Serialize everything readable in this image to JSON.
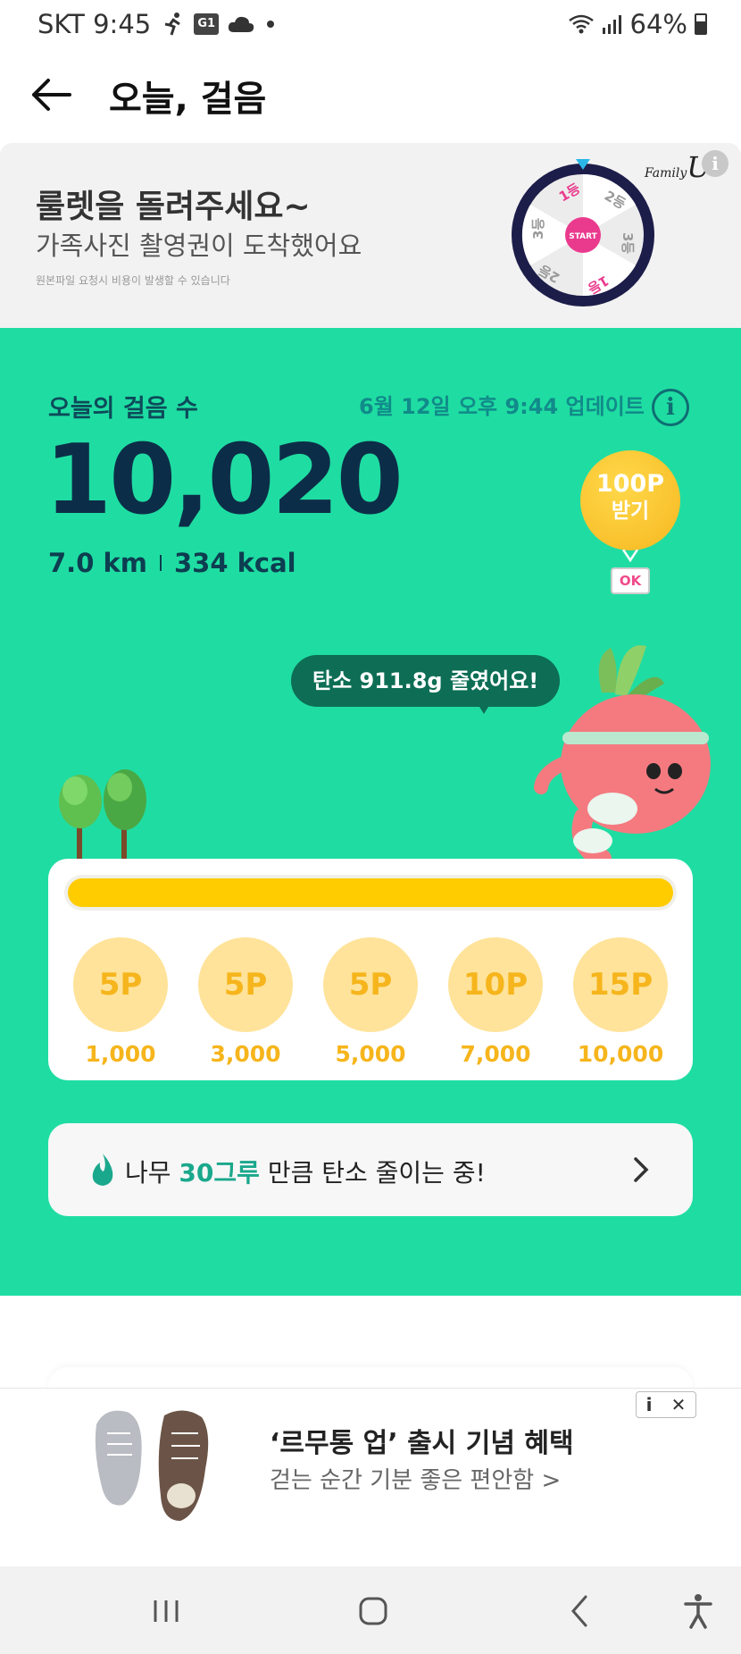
{
  "status_bar": {
    "carrier_time": "SKT 9:45",
    "badge": "G1",
    "battery": "64%",
    "icons": [
      "runner-icon",
      "g1-badge-icon",
      "cloud-icon",
      "dot-icon",
      "wifi-icon",
      "signal-icon",
      "battery-icon"
    ]
  },
  "header": {
    "back_icon": "arrow-left-icon",
    "title": "오늘, 걸음"
  },
  "banner": {
    "title": "룰렛을 돌려주세요~",
    "subtitle": "가족사진 촬영권이 도착했어요",
    "note": "원본파일 요청시 비용이 발생할 수 있습니다",
    "roulette": {
      "center_label": "START",
      "segments": [
        "1등",
        "2등",
        "3등",
        "1등",
        "2등",
        "3등"
      ]
    },
    "logo": "Family",
    "logo_mark": "U",
    "info_icon": "i"
  },
  "steps": {
    "label": "오늘의 걸음 수",
    "updated": "6월 12일 오후 9:44 업데이트",
    "info_icon": "i",
    "count": "10,020",
    "distance": "7.0 km",
    "calories": "334 kcal"
  },
  "reward_balloon": {
    "amount": "100P",
    "label": "받기",
    "tag": "OK"
  },
  "speech": {
    "text": "탄소 911.8g 줄였어요!"
  },
  "progress": {
    "fill_fraction": 1.0,
    "milestones": [
      {
        "points": "5P",
        "steps": "1,000"
      },
      {
        "points": "5P",
        "steps": "3,000"
      },
      {
        "points": "5P",
        "steps": "5,000"
      },
      {
        "points": "10P",
        "steps": "7,000"
      },
      {
        "points": "15P",
        "steps": "10,000"
      }
    ]
  },
  "carbon": {
    "prefix": "나무 ",
    "highlight": "30그루",
    "suffix": " 만큼 탄소 줄이는 중!",
    "icon": "fire-icon",
    "chevron": "chevron-right-icon"
  },
  "ad": {
    "title": "‘르무통 업’ 출시 기념 혜택",
    "subtitle": "걷는 순간 기분 좋은 편안함 >",
    "info_label": "i",
    "close_label": "✕"
  },
  "nav": [
    "recent-apps-icon",
    "home-icon",
    "back-icon",
    "accessibility-icon"
  ],
  "colors": {
    "green_bg": "#1fdda2",
    "step_count": "#0c2d48",
    "progress_fill": "#ffcc00",
    "coin": "#ffe39a",
    "coin_text": "#f6b51c",
    "highlight": "#1aa88c"
  }
}
